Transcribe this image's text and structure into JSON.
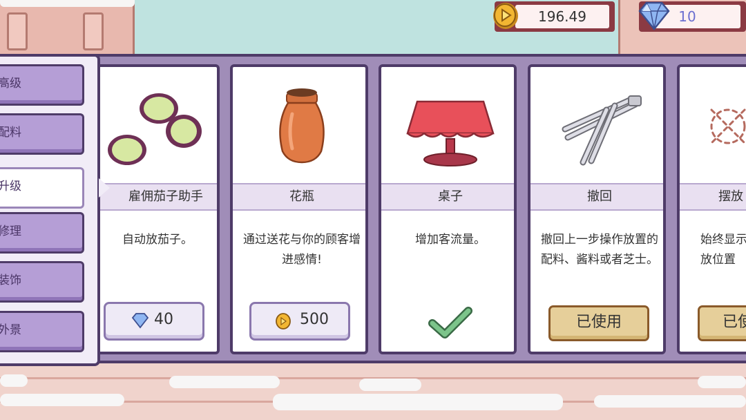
{
  "currency": {
    "coins": "196.49",
    "gems": "10"
  },
  "sidebar": {
    "items": [
      {
        "label": "高级"
      },
      {
        "label": "配料"
      },
      {
        "label": "升级"
      },
      {
        "label": "修理"
      },
      {
        "label": "装饰"
      },
      {
        "label": "外景"
      }
    ],
    "active_index": 2
  },
  "cards": [
    {
      "title": "雇佣茄子助手",
      "desc": "自动放茄子。",
      "price": "40",
      "price_currency": "gem-icon"
    },
    {
      "title": "花瓶",
      "desc": "通过送花与你的顾客增进感情!",
      "price": "500",
      "price_currency": "coin-icon"
    },
    {
      "title": "桌子",
      "desc": "增加客流量。",
      "status": "owned"
    },
    {
      "title": "撤回",
      "desc": "撤回上一步操作放置的配料、酱料或者芝士。",
      "button": "已使用"
    },
    {
      "title": "摆放",
      "desc": "始终显示放位置",
      "button": "已使"
    }
  ]
}
